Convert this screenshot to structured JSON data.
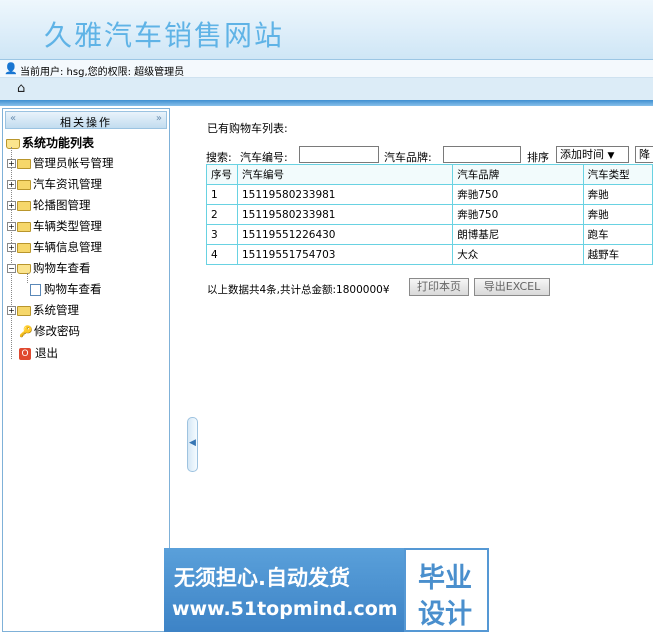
{
  "site": {
    "title": "久雅汽车销售网站"
  },
  "userbar": {
    "text": "当前用户: hsg,您的权限: 超级管理员"
  },
  "sidebar": {
    "header": "相关操作",
    "root": "系统功能列表",
    "items": [
      {
        "label": "管理员帐号管理"
      },
      {
        "label": "汽车资讯管理"
      },
      {
        "label": "轮播图管理"
      },
      {
        "label": "车辆类型管理"
      },
      {
        "label": "车辆信息管理"
      },
      {
        "label": "购物车查看"
      },
      {
        "label": "购物车查看"
      },
      {
        "label": "系统管理"
      },
      {
        "label": "修改密码"
      },
      {
        "label": "退出"
      }
    ]
  },
  "content": {
    "list_title": "已有购物车列表:",
    "search": {
      "search_label": "搜索:",
      "car_no_label": "汽车编号:",
      "car_brand_label": "汽车品牌:",
      "sort_label": "排序",
      "sort_value": "添加时间",
      "order_value": "降"
    },
    "table": {
      "headers": [
        "序号",
        "汽车编号",
        "汽车品牌",
        "汽车类型"
      ],
      "rows": [
        [
          "1",
          "15119580233981",
          "奔驰750",
          "奔驰"
        ],
        [
          "2",
          "15119580233981",
          "奔驰750",
          "奔驰"
        ],
        [
          "3",
          "15119551226430",
          "朗博基尼",
          "跑车"
        ],
        [
          "4",
          "15119551754703",
          "大众",
          "越野车"
        ]
      ]
    },
    "summary": "以上数据共4条,共计总金额:1800000¥",
    "print_button": "打印本页",
    "export_button": "导出EXCEL"
  },
  "watermark": {
    "line1": "无须担心.自动发货",
    "line2": "www.51topmind.com",
    "right1": "毕业",
    "right2": "设计"
  }
}
